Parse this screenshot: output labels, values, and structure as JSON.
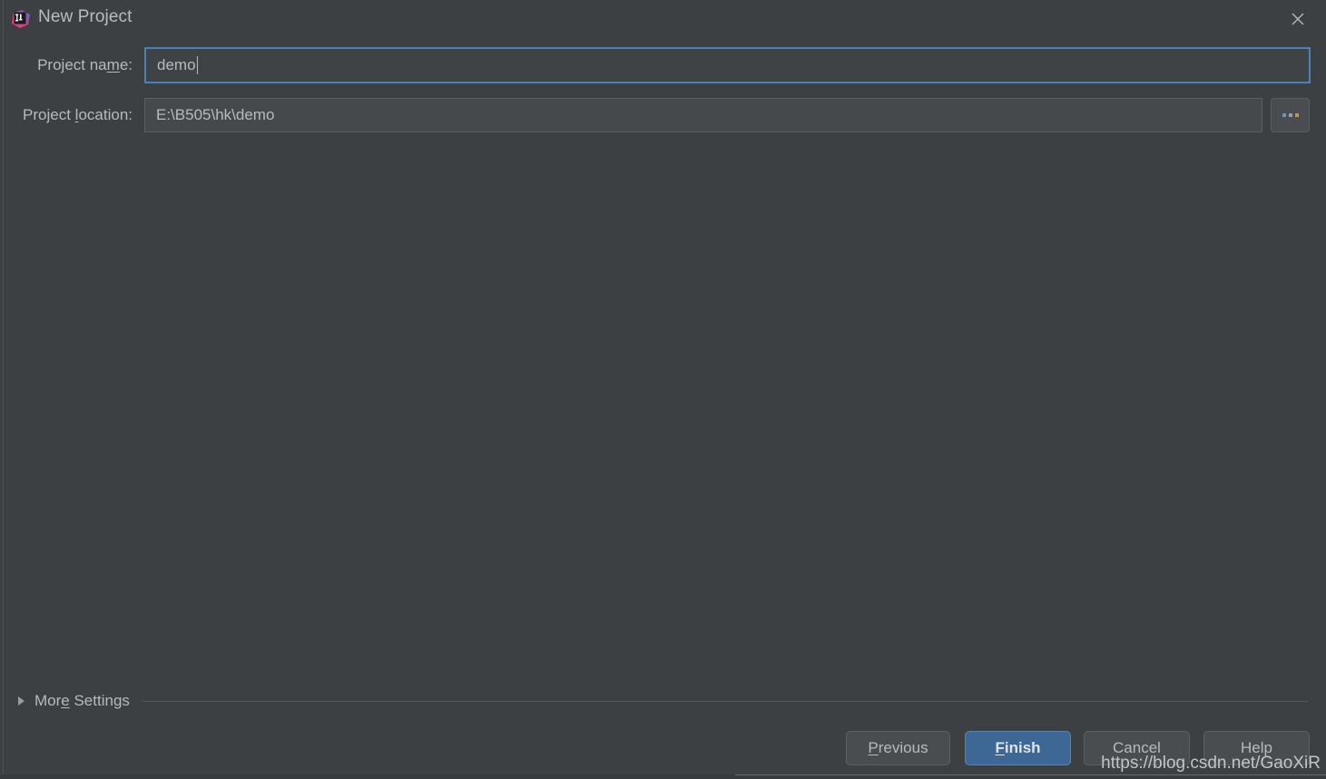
{
  "window": {
    "title": "New Project",
    "app_icon": "intellij-idea-icon",
    "close_icon": "close-icon"
  },
  "form": {
    "project_name": {
      "label_pre": "Project na",
      "label_mnemonic": "m",
      "label_post": "e:",
      "label_full": "Project name:",
      "value": "demo",
      "focused": true
    },
    "project_location": {
      "label_pre": "Project ",
      "label_mnemonic": "l",
      "label_post": "ocation:",
      "label_full": "Project location:",
      "value": "E:\\B505\\hk\\demo",
      "browse_label": "...",
      "browse_icon": "ellipsis-icon"
    }
  },
  "more_settings": {
    "label_pre": "Mor",
    "label_mnemonic": "e",
    "label_post": " Settings",
    "label_full": "More Settings",
    "expanded": false,
    "disclosure_icon": "triangle-right-icon"
  },
  "footer": {
    "buttons": [
      {
        "name": "previous",
        "pre": "",
        "mnemonic": "P",
        "post": "revious",
        "label": "Previous",
        "primary": false
      },
      {
        "name": "finish",
        "pre": "",
        "mnemonic": "F",
        "post": "inish",
        "label": "Finish",
        "primary": true
      },
      {
        "name": "cancel",
        "pre": "Cancel",
        "mnemonic": "",
        "post": "",
        "label": "Cancel",
        "primary": false
      },
      {
        "name": "help",
        "pre": "Help",
        "mnemonic": "",
        "post": "",
        "label": "Help",
        "primary": false
      }
    ]
  },
  "watermark": {
    "text": "https://blog.csdn.net/GaoXiR"
  },
  "colors": {
    "background": "#3c4043",
    "input_background": "#45494b",
    "focus_border": "#4b81b4",
    "border": "#5b5e60",
    "primary_button": "#3d6896",
    "text": "#b7babc"
  }
}
